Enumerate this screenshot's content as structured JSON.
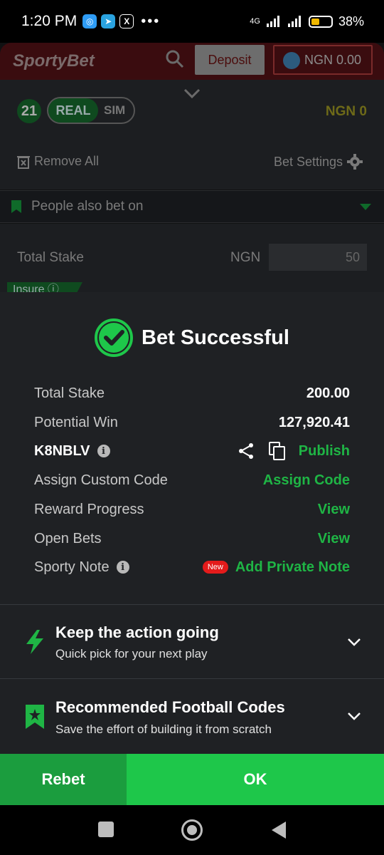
{
  "status_bar": {
    "time": "1:20 PM",
    "dots": "•••",
    "network": "4G",
    "battery": "38%"
  },
  "header": {
    "logo": "SportyBet",
    "deposit_label": "Deposit",
    "balance": "NGN 0.00"
  },
  "betslip": {
    "count": "21",
    "mode_real": "REAL",
    "mode_sim": "SIM",
    "total_amount": "NGN 0",
    "remove_all": "Remove All",
    "bet_settings": "Bet Settings",
    "people_also_bet": "People also bet on",
    "total_stake_label": "Total Stake",
    "currency": "NGN",
    "stake_value": "50",
    "insure_label": "Insure"
  },
  "success": {
    "title": "Bet Successful",
    "rows": {
      "total_stake_label": "Total Stake",
      "total_stake_value": "200.00",
      "potential_win_label": "Potential Win",
      "potential_win_value": "127,920.41",
      "booking_code": "K8NBLV",
      "publish_label": "Publish",
      "assign_custom_code_label": "Assign Custom Code",
      "assign_code_action": "Assign Code",
      "reward_progress_label": "Reward Progress",
      "reward_view": "View",
      "open_bets_label": "Open Bets",
      "open_bets_view": "View",
      "sporty_note_label": "Sporty Note",
      "new_badge": "New",
      "add_private_note": "Add Private Note"
    },
    "cards": [
      {
        "title": "Keep the action going",
        "subtitle": "Quick pick for your next play"
      },
      {
        "title": "Recommended Football Codes",
        "subtitle": "Save the effort of building it from scratch"
      }
    ]
  },
  "footer": {
    "rebet_label": "Rebet",
    "ok_label": "OK"
  },
  "colors": {
    "accent_green": "#1ec74a",
    "brand_red": "#e41b1b",
    "sheet_bg": "#1f2124"
  }
}
